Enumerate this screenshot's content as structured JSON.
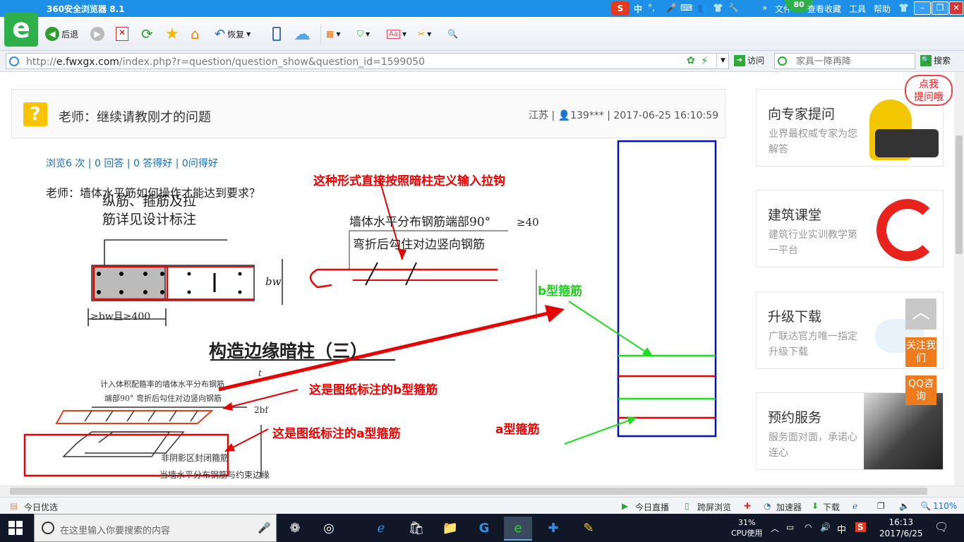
{
  "window": {
    "title": "360安全浏览器 8.1",
    "badge": "80",
    "menus": [
      "文件",
      "查看",
      "收藏",
      "工具",
      "帮助"
    ],
    "chevron": "»",
    "ime": "中"
  },
  "toolbar": {
    "back": "后退",
    "restore": "恢复"
  },
  "address": {
    "url_prefix": "http://",
    "url_domain": "e.fwxgx.com",
    "url_path": "/index.php?r=question/question_show&question_id=1599050",
    "visit": "访问",
    "search_placeholder": "家具一降再降",
    "search_button": "搜索"
  },
  "question": {
    "title": "老师：继续请教刚才的问题",
    "region": "江苏",
    "user": "139***",
    "date": "2017-06-25 16:10:59",
    "stats": "浏览6 次 | 0 回答 | 0 答得好 | 0问得好",
    "body": "老师：墙体水平筋如何操作才能达到要求？"
  },
  "drawing": {
    "ann_top": "这种形式直接按照暗柱定义输入拉钩",
    "ann_b_mark": "这是图纸标注的b型箍筋",
    "ann_a_mark": "这是图纸标注的a型箍筋",
    "label_b": "b型箍筋",
    "label_a": "a型箍筋",
    "cad_1": "纵筋、箍筋及拉",
    "cad_2": "筋详见设计标注",
    "cad_3": "墙体水平分布钢筋端部90°",
    "cad_4": "弯折后勾住对边竖向钢筋",
    "cad_5": "≥bw且≥400",
    "cad_6": "bw",
    "cad_7": "≥40",
    "cad_title": "构造边缘暗柱（三）",
    "cad_8": "计入体积配箍率的墙体水平分布钢筋",
    "cad_9": "端部90° 弯折后勾住对边竖向钢筋",
    "cad_10": "非阴影区封闭箍筋",
    "cad_11": "当墙水平分布钢筋与约束边缘",
    "cad_12": "2bf",
    "cad_13": "t",
    "colors": {
      "red": "#e60000",
      "green": "#1fdc1f",
      "blue": "#0010c8"
    }
  },
  "sidebar": {
    "bubble": "点我\n提问哦",
    "cards": [
      {
        "title": "向专家提问",
        "sub": "业界最权威专家为您解答"
      },
      {
        "title": "建筑课堂",
        "sub": "建筑行业实训教学第一平台"
      },
      {
        "title": "升级下载",
        "sub": "广联达官方唯一指定升级下载"
      },
      {
        "title": "预约服务",
        "sub": "服务面对面，承诺心连心"
      }
    ],
    "follow": "关注我们",
    "qq": "QQ咨询"
  },
  "statusbar": {
    "left": "今日优选",
    "live": "今日直播",
    "cross": "跨屏浏览",
    "accel": "加速器",
    "download": "下载",
    "zoom": "110%"
  },
  "taskbar": {
    "search_placeholder": "在这里输入你要搜索的内容",
    "cpu_pct": "31%",
    "cpu_label": "CPU使用",
    "ime": "中",
    "time": "16:13",
    "date": "2017/6/25"
  }
}
